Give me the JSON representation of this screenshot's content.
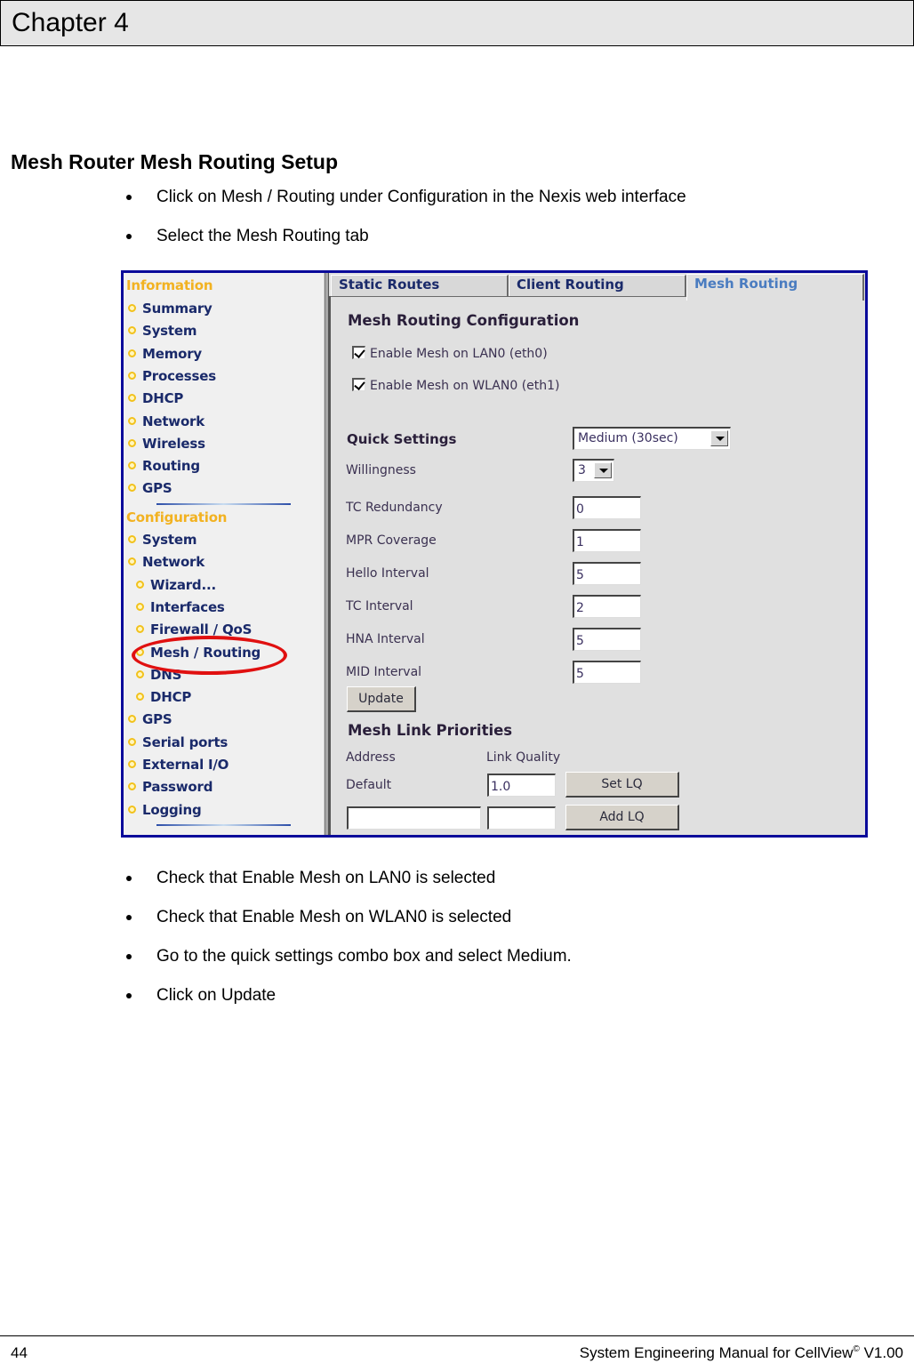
{
  "chapter": {
    "title": "Chapter 4"
  },
  "section": {
    "title": "Mesh Router Mesh Routing Setup"
  },
  "steps_before": [
    "Click on Mesh / Routing under Configuration in the Nexis web interface",
    "Select the Mesh Routing tab"
  ],
  "steps_after": [
    "Check that Enable Mesh on LAN0 is selected",
    "Check that Enable Mesh on WLAN0 is selected",
    "Go to the quick settings combo box and select Medium.",
    "Click on Update"
  ],
  "screenshot": {
    "sidebar": {
      "information_heading": "Information",
      "information_items": [
        "Summary",
        "System",
        "Memory",
        "Processes",
        "DHCP",
        "Network",
        "Wireless",
        "Routing",
        "GPS"
      ],
      "configuration_heading": "Configuration",
      "configuration_items": [
        {
          "label": "System",
          "level": 0
        },
        {
          "label": "Network",
          "level": 0
        },
        {
          "label": "Wizard...",
          "level": 1
        },
        {
          "label": "Interfaces",
          "level": 1
        },
        {
          "label": "Firewall / QoS",
          "level": 1
        },
        {
          "label": "Mesh / Routing",
          "level": 1,
          "highlighted": true
        },
        {
          "label": "DNS",
          "level": 1
        },
        {
          "label": "DHCP",
          "level": 1
        },
        {
          "label": "GPS",
          "level": 0
        },
        {
          "label": "Serial ports",
          "level": 0
        },
        {
          "label": "External I/O",
          "level": 0
        },
        {
          "label": "Password",
          "level": 0
        },
        {
          "label": "Logging",
          "level": 0
        }
      ],
      "highlight_color": "#e01010"
    },
    "tabs": [
      {
        "label": "Static Routes",
        "active": false
      },
      {
        "label": "Client Routing",
        "active": false
      },
      {
        "label": "Mesh Routing",
        "active": true
      }
    ],
    "config": {
      "heading": "Mesh Routing Configuration",
      "enable_lan0": {
        "label": "Enable Mesh on LAN0 (eth0)",
        "checked": true
      },
      "enable_wlan0": {
        "label": "Enable Mesh on WLAN0 (eth1)",
        "checked": true
      },
      "quick_settings": {
        "label": "Quick Settings",
        "value": "Medium (30sec)"
      },
      "willingness": {
        "label": "Willingness",
        "value": "3"
      },
      "fields": [
        {
          "label": "TC Redundancy",
          "value": "0"
        },
        {
          "label": "MPR Coverage",
          "value": "1"
        },
        {
          "label": "Hello Interval",
          "value": "5"
        },
        {
          "label": "TC Interval",
          "value": "2"
        },
        {
          "label": "HNA Interval",
          "value": "5"
        },
        {
          "label": "MID Interval",
          "value": "5"
        }
      ],
      "update_button": "Update"
    },
    "link_priorities": {
      "heading": "Mesh Link Priorities",
      "address_header": "Address",
      "link_quality_header": "Link Quality",
      "default_label": "Default",
      "default_lq": "1.0",
      "set_lq_button": "Set LQ",
      "new_address": "",
      "new_lq": "",
      "add_lq_button": "Add LQ"
    }
  },
  "footer": {
    "page_number": "44",
    "title": "System Engineering Manual for CellView",
    "title_sup": "©",
    "version": " V1.00"
  }
}
